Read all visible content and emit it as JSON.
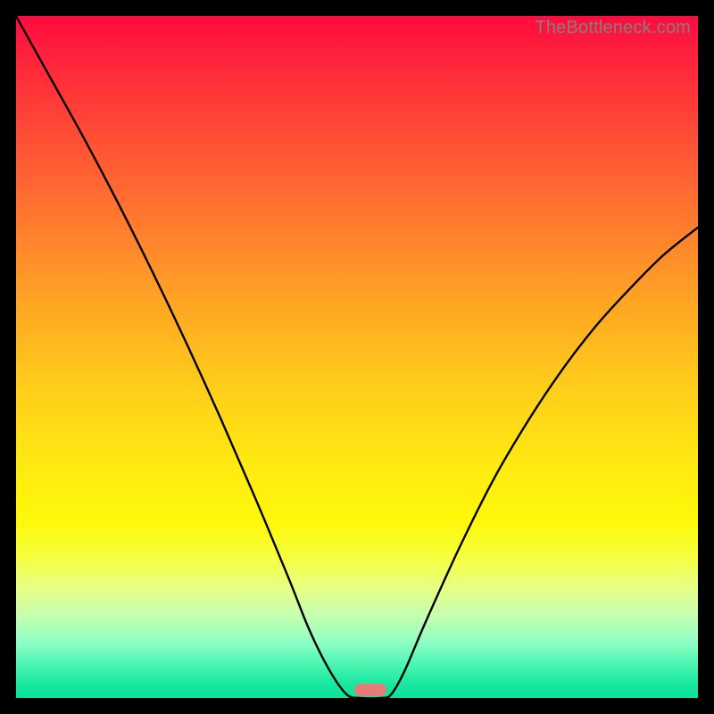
{
  "watermark": "TheBottleneck.com",
  "chart_data": {
    "type": "line",
    "title": "",
    "xlabel": "",
    "ylabel": "",
    "xlim": [
      0,
      100
    ],
    "ylim": [
      0,
      100
    ],
    "grid": false,
    "series": [
      {
        "name": "bottleneck-curve",
        "x": [
          0,
          5,
          10,
          15,
          20,
          25,
          30,
          35,
          40,
          43,
          46,
          48.5,
          50.5,
          53.5,
          55,
          57,
          60,
          65,
          70,
          75,
          80,
          85,
          90,
          95,
          100
        ],
        "y": [
          100,
          91,
          82,
          72.5,
          62.5,
          52,
          41,
          29.5,
          17.5,
          10,
          4,
          0.5,
          0,
          0,
          0.5,
          4,
          11,
          22,
          32,
          40.5,
          48,
          54.5,
          60,
          65,
          69
        ]
      }
    ],
    "marker": {
      "x_center": 52,
      "width_percent": 4.7
    },
    "background_gradient": {
      "stops": [
        {
          "pos": 0,
          "color": "#ff0b3f"
        },
        {
          "pos": 18,
          "color": "#ff4f36"
        },
        {
          "pos": 42,
          "color": "#ffa524"
        },
        {
          "pos": 65,
          "color": "#ffe812"
        },
        {
          "pos": 84,
          "color": "#e6ff86"
        },
        {
          "pos": 100,
          "color": "#0be29a"
        }
      ]
    }
  }
}
